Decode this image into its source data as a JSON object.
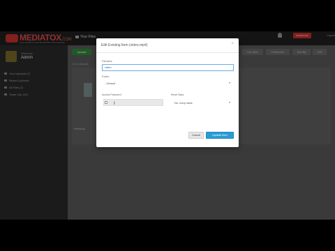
{
  "app": {
    "brand_name": "MEDIATOX",
    "brand_suffix": ".COM",
    "brand_tagline": "FILE SHARING AND BANDWIDTH BALANCING",
    "nav_files_label": "Your Files",
    "download_label": "DOWNLOAD",
    "logout_label": "Logout"
  },
  "sidebar": {
    "welcome": "Welcome,",
    "username": "Admin",
    "items": [
      {
        "label": "Your Uploads (7)",
        "icon": "upload-icon"
      },
      {
        "label": "Recent Uploads",
        "icon": "clock-icon"
      },
      {
        "label": "All Files (7)",
        "icon": "files-icon"
      },
      {
        "label": "Trash Can (10)",
        "icon": "trash-icon"
      }
    ]
  },
  "main": {
    "upload_label": "Upload",
    "list_view_label": "List View",
    "fullscreen_label": "Fullscreen",
    "sort_label": "Sort By",
    "per_page_label": "100",
    "breadcrumb": "Your Uploads",
    "prev_label": "Previous"
  },
  "modal": {
    "title": "Edit Existing Item (video.mp4)",
    "close_glyph": "×",
    "filename_label": "Filename:",
    "filename_value": "video",
    "folder_label": "Folder:",
    "folder_value": "- Default -",
    "access_password_label": "Access Password:",
    "reset_stats_label": "Reset Stats:",
    "reset_stats_value": "No, keep stats",
    "cancel_label": "Cancel",
    "update_label": "Update Item"
  },
  "colors": {
    "accent_blue": "#2a9bd6",
    "brand_red": "#c9302c",
    "upload_green": "#2e8b3a"
  }
}
